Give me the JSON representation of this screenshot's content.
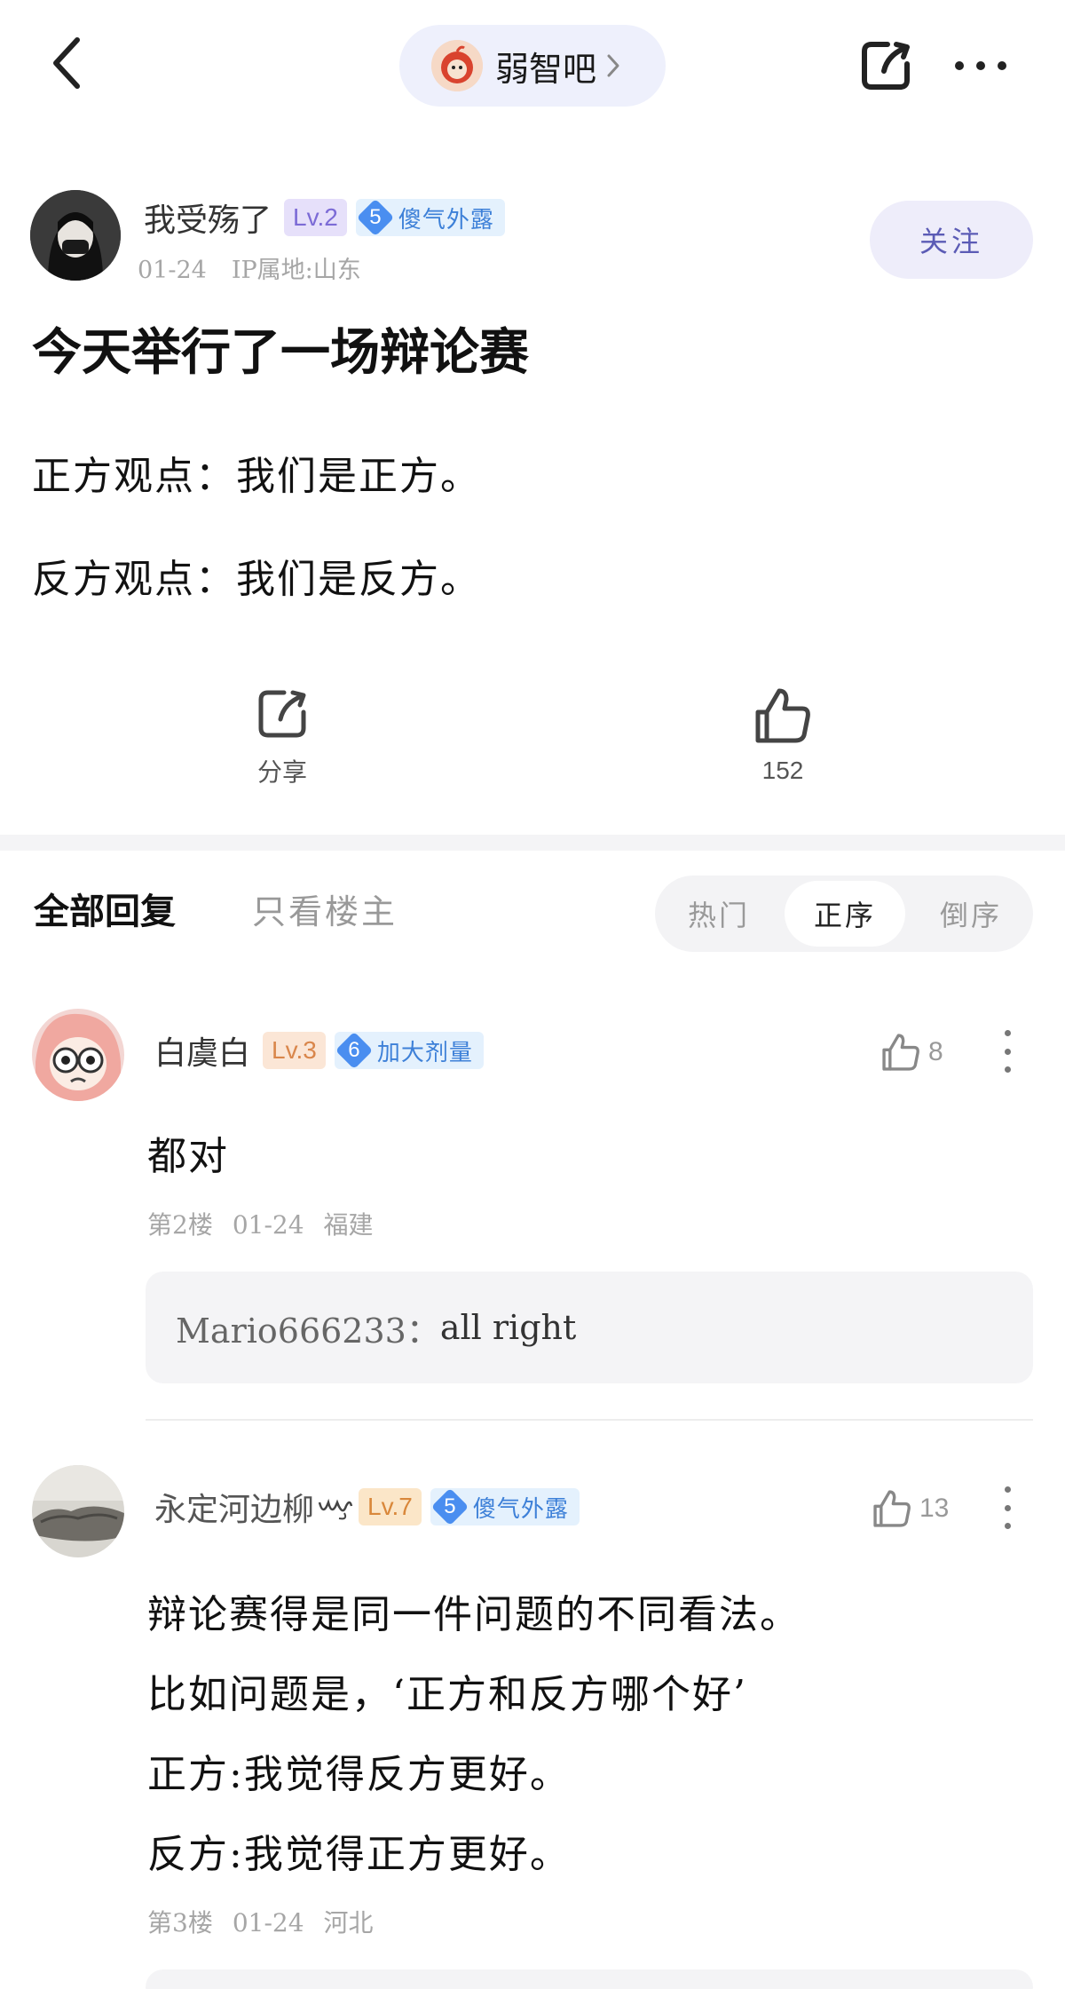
{
  "header": {
    "forum_name": "弱智吧"
  },
  "post": {
    "author": {
      "name": "我受殇了",
      "level": "Lv.2",
      "title_level": "5",
      "title": "傻气外露",
      "date": "01-24",
      "ip_location": "IP属地:山东"
    },
    "follow_label": "关注",
    "title": "今天举行了一场辩论赛",
    "body": [
      "正方观点：我们是正方。",
      "反方观点：我们是反方。"
    ],
    "share_label": "分享",
    "like_count": "152"
  },
  "replies_filter": {
    "all_label": "全部回复",
    "op_only_label": "只看楼主",
    "sort_options": [
      "热门",
      "正序",
      "倒序"
    ],
    "active_sort": "正序"
  },
  "comments": [
    {
      "name": "白虞白",
      "level": "Lv.3",
      "title_level": "6",
      "title": "加大剂量",
      "likes": "8",
      "text": "都对",
      "floor": "第2楼",
      "date": "01-24",
      "location": "福建",
      "sub_reply": {
        "user": "Mario666233：",
        "text": "all right"
      }
    },
    {
      "name": "永定河边柳",
      "level": "Lv.7",
      "title_level": "5",
      "title": "傻气外露",
      "likes": "13",
      "lines": [
        "辩论赛得是同一件问题的不同看法。",
        "比如问题是，‘正方和反方哪个好’",
        "正方:我觉得反方更好。",
        "反方:我觉得正方更好。"
      ],
      "floor": "第3楼",
      "date": "01-24",
      "location": "河北"
    }
  ],
  "colors": {
    "accent_purple": "#7c6bd6",
    "title_blue": "#3d80d8",
    "follow_bg": "#eeedfa"
  },
  "icons": [
    "back-arrow-icon",
    "forum-avatar-icon",
    "chevron-right-icon",
    "share-icon",
    "more-icon",
    "thumbs-up-icon"
  ]
}
